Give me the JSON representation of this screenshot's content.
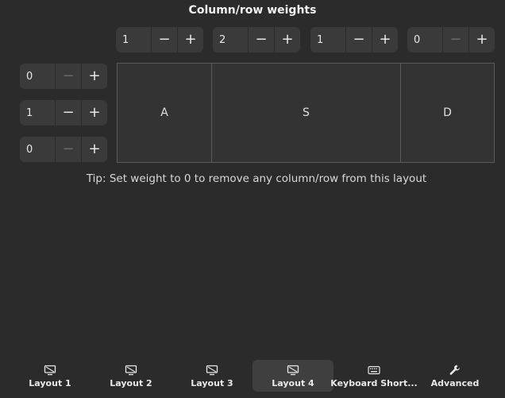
{
  "title": "Column/row weights",
  "column_weights": [
    {
      "value": "1",
      "minus": "−",
      "plus": "+",
      "minus_disabled": false
    },
    {
      "value": "2",
      "minus": "−",
      "plus": "+",
      "minus_disabled": false
    },
    {
      "value": "1",
      "minus": "−",
      "plus": "+",
      "minus_disabled": false
    },
    {
      "value": "0",
      "minus": "−",
      "plus": "+",
      "minus_disabled": true
    }
  ],
  "row_weights": [
    {
      "value": "0",
      "minus": "−",
      "plus": "+",
      "minus_disabled": true
    },
    {
      "value": "1",
      "minus": "−",
      "plus": "+",
      "minus_disabled": false
    },
    {
      "value": "0",
      "minus": "−",
      "plus": "+",
      "minus_disabled": true
    }
  ],
  "layout_cells": [
    "A",
    "S",
    "D"
  ],
  "tip": "Tip: Set weight to 0 to remove any column/row from this layout",
  "tabs": [
    {
      "label": "Layout 1",
      "icon": "monitor-icon",
      "active": false
    },
    {
      "label": "Layout 2",
      "icon": "monitor-icon",
      "active": false
    },
    {
      "label": "Layout 3",
      "icon": "monitor-icon",
      "active": false
    },
    {
      "label": "Layout 4",
      "icon": "monitor-icon",
      "active": true
    },
    {
      "label": "Keyboard Short...",
      "icon": "keyboard-icon",
      "active": false
    },
    {
      "label": "Advanced",
      "icon": "wrench-icon",
      "active": false
    }
  ],
  "colors": {
    "background": "#2b2b2b",
    "spin_background": "#3a3a3a",
    "active_tab": "#3f3f3f"
  }
}
